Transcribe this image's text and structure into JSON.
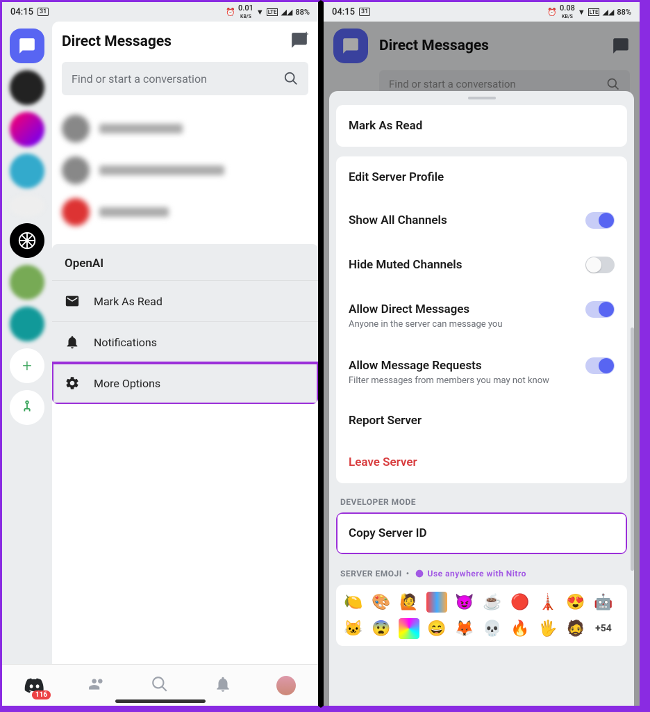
{
  "status": {
    "time": "04:15",
    "date_icon": "31",
    "kb_left": "0.01",
    "kb_right": "0.08",
    "kb_unit": "KB/S",
    "battery": "88%"
  },
  "left": {
    "header_title": "Direct Messages",
    "search_placeholder": "Find or start a conversation",
    "context_menu": {
      "title": "OpenAI",
      "items": [
        "Mark As Read",
        "Notifications",
        "More Options"
      ]
    },
    "badge_count": "116"
  },
  "right": {
    "bg_title": "Direct Messages",
    "bg_search": "Find or start a conversation",
    "mark_read": "Mark As Read",
    "rows": {
      "edit_profile": "Edit Server Profile",
      "show_all": "Show All Channels",
      "hide_muted": "Hide Muted Channels",
      "allow_dm": "Allow Direct Messages",
      "allow_dm_sub": "Anyone in the server can message you",
      "allow_req": "Allow Message Requests",
      "allow_req_sub": "Filter messages from members you may not know",
      "report": "Report Server",
      "leave": "Leave Server",
      "copy_id": "Copy Server ID"
    },
    "sections": {
      "dev_mode": "DEVELOPER MODE",
      "server_emoji": "SERVER EMOJI",
      "nitro": "Use anywhere with Nitro"
    },
    "more_emoji": "+54"
  }
}
